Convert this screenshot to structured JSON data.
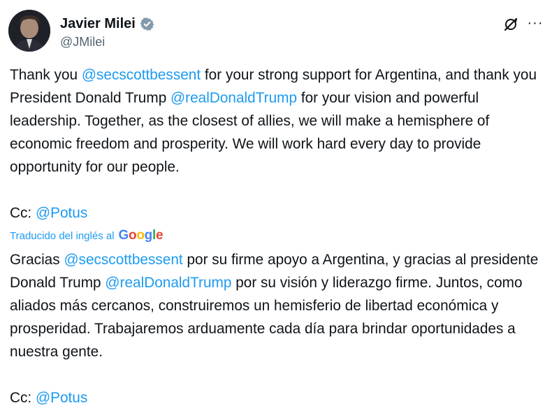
{
  "author": {
    "display_name": "Javier Milei",
    "handle": "@JMilei",
    "verified_icon": "verified-badge-icon"
  },
  "actions": {
    "grok_icon": "grok-icon",
    "more_icon": "more-options-icon",
    "more_glyph": "···"
  },
  "tweet": {
    "original": {
      "p1_a": "Thank you ",
      "mention1": "@secscottbessent",
      "p1_b": " for your strong support for Argentina, and thank you President Donald Trump ",
      "mention2": "@realDonaldTrump",
      "p1_c": " for your vision and powerful leadership. Together, as the closest of allies, we will make a hemisphere of economic freedom and prosperity. We will work hard every day to provide opportunity for our people.",
      "cc_label": "Cc: ",
      "cc_mention": "@Potus"
    },
    "translation_label": "Traducido del inglés al",
    "translation_provider": "Google",
    "translated": {
      "p1_a": "Gracias ",
      "mention1": "@secscottbessent",
      "p1_b": " por su firme apoyo a Argentina, y gracias al presidente Donald Trump ",
      "mention2": "@realDonaldTrump",
      "p1_c": " por su visión y liderazgo firme. Juntos, como aliados más cercanos, construiremos un hemisferio de libertad económica y prosperidad. Trabajaremos arduamente cada día para brindar oportunidades a nuestra gente.",
      "cc_label": "Cc: ",
      "cc_mention": "@Potus"
    }
  },
  "colors": {
    "link": "#1d9bf0",
    "text": "#0f1419",
    "secondary": "#536471"
  }
}
